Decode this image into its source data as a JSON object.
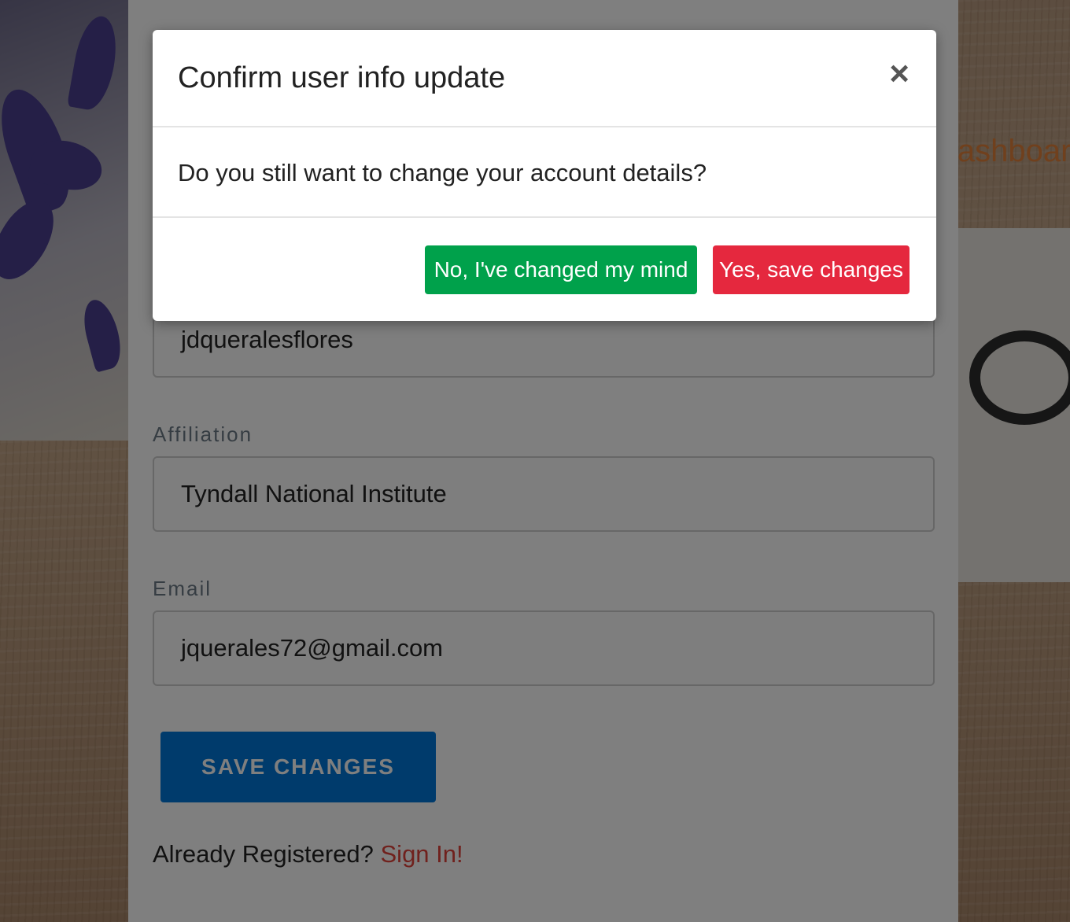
{
  "background": {
    "nav_link": "Dashboar"
  },
  "form": {
    "username_value": "jdqueralesflores",
    "affiliation_label": "Affiliation",
    "affiliation_value": "Tyndall National Institute",
    "email_label": "Email",
    "email_value": "jquerales72@gmail.com",
    "save_label": "SAVE CHANGES",
    "already_text": "Already Registered? ",
    "signin_link": "Sign In!"
  },
  "modal": {
    "title": "Confirm user info update",
    "close_icon": "close-icon",
    "close_glyph": "×",
    "message": "Do you still want to change your account details?",
    "no_button": "No, I've changed my mind",
    "yes_button": "Yes, save changes"
  },
  "colors": {
    "no_button": "#00a14b",
    "yes_button": "#e5283e",
    "save_button": "#0077d9",
    "link": "#e0433a",
    "nav_link": "#e0813a"
  }
}
